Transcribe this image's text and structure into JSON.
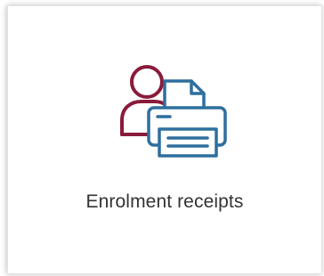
{
  "tile": {
    "label": "Enrolment receipts",
    "icon": "user-printer-icon"
  },
  "colors": {
    "person": "#8a1b3a",
    "printer": "#2e6f9e",
    "printer_fill": "#ffffff",
    "text": "#333333"
  }
}
